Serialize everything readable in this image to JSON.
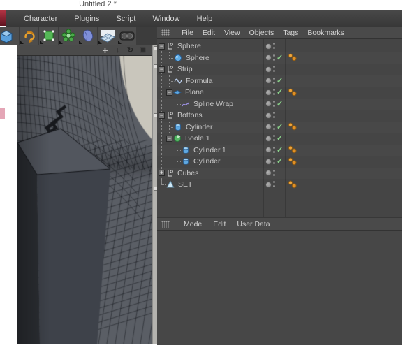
{
  "window": {
    "title": "Untitled 2 *"
  },
  "menubar": {
    "items": [
      "Character",
      "Plugins",
      "Script",
      "Window",
      "Help"
    ]
  },
  "toolbar": {
    "icons": [
      "cube-primitive-icon",
      "rotate-tool-icon",
      "editable-object-icon",
      "array-object-icon",
      "deformer-object-icon",
      "floor-object-icon",
      "camera-object-icon"
    ]
  },
  "viewport": {
    "nav_icons": [
      "pan-icon",
      "zoom-icon",
      "rotate-view-icon",
      "toggle-layout-icon"
    ]
  },
  "object_manager": {
    "menu": [
      "File",
      "Edit",
      "View",
      "Objects",
      "Tags",
      "Bookmarks"
    ],
    "rows": [
      {
        "label": "Sphere",
        "level": 0,
        "icon": "null",
        "expander": "minus",
        "connector": "none",
        "check": false,
        "tag": false
      },
      {
        "label": "Sphere",
        "level": 1,
        "icon": "sphere",
        "expander": "none",
        "connector": "last",
        "check": true,
        "tag": true
      },
      {
        "label": "Strip",
        "level": 0,
        "icon": "null",
        "expander": "minus",
        "connector": "none",
        "check": false,
        "tag": false
      },
      {
        "label": "Formula",
        "level": 1,
        "icon": "formula",
        "expander": "none",
        "connector": "mid",
        "check": true,
        "tag": false
      },
      {
        "label": "Plane",
        "level": 1,
        "icon": "plane",
        "expander": "minus",
        "connector": "none",
        "check": true,
        "tag": true
      },
      {
        "label": "Spline Wrap",
        "level": 2,
        "icon": "splinewrap",
        "expander": "none",
        "connector": "last",
        "check": true,
        "tag": false
      },
      {
        "label": "Bottons",
        "level": 0,
        "icon": "null",
        "expander": "minus",
        "connector": "none",
        "check": false,
        "tag": false
      },
      {
        "label": "Cylinder",
        "level": 1,
        "icon": "cylinder",
        "expander": "none",
        "connector": "mid",
        "check": true,
        "tag": true
      },
      {
        "label": "Boole.1",
        "level": 1,
        "icon": "boole",
        "expander": "minus",
        "connector": "none",
        "check": true,
        "tag": false
      },
      {
        "label": "Cylinder.1",
        "level": 2,
        "icon": "cylinder",
        "expander": "none",
        "connector": "mid",
        "check": true,
        "tag": true
      },
      {
        "label": "Cylinder",
        "level": 2,
        "icon": "cylinder",
        "expander": "none",
        "connector": "last",
        "check": true,
        "tag": true
      },
      {
        "label": "Cubes",
        "level": 0,
        "icon": "null",
        "expander": "plus",
        "connector": "none",
        "check": false,
        "tag": false
      },
      {
        "label": "SET",
        "level": 0,
        "icon": "cone",
        "expander": "none",
        "connector": "last",
        "check": false,
        "tag": true
      }
    ]
  },
  "attribute_manager": {
    "menu": [
      "Mode",
      "Edit",
      "User Data"
    ]
  },
  "colors": {
    "check_green": "#8bd48b",
    "tag_orange": "#eda238",
    "object_blue": "#5fa8e0",
    "boole_green": "#56b865",
    "panel_gray": "#474747",
    "viewport_gray": "#5a5e65"
  }
}
